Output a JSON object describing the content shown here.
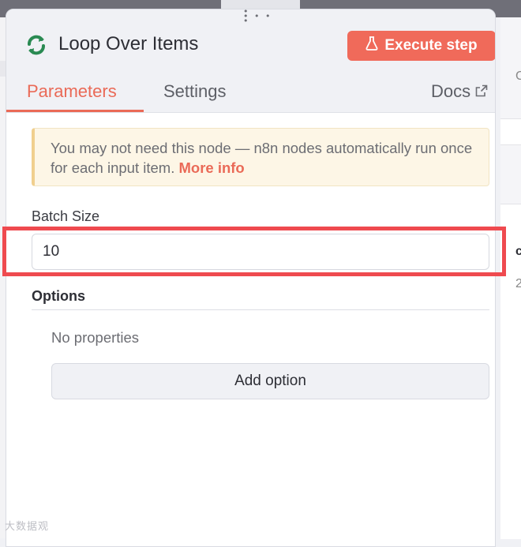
{
  "panel": {
    "title": "Loop Over Items",
    "node_icon": "refresh-arrows-icon",
    "execute_button_label": "Execute step",
    "execute_icon": "flask-icon"
  },
  "tabs": [
    {
      "label": "Parameters",
      "active": true
    },
    {
      "label": "Settings",
      "active": false
    },
    {
      "label": "Docs",
      "icon": "external-link-icon"
    }
  ],
  "notice": {
    "text": "You may not need this node — n8n nodes automatically run once for each input item.",
    "link_label": "More info"
  },
  "batch_size": {
    "label": "Batch Size",
    "value": "10"
  },
  "options": {
    "label": "Options",
    "empty_text": "No properties",
    "add_button_label": "Add option"
  },
  "watermark": "大数据观",
  "colors": {
    "accent": "#ea6a57",
    "execute_button": "#f06a5a",
    "highlight_box": "#ef4a4f",
    "node_icon": "#2a8a52",
    "notice_bg": "#fdf6e6"
  }
}
